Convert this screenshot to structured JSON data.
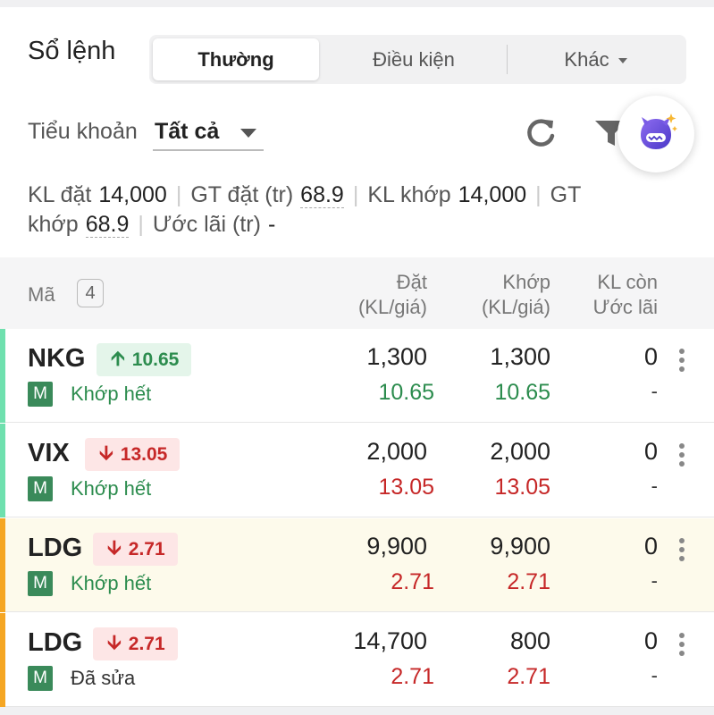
{
  "header": {
    "title": "Sổ lệnh",
    "tabs": [
      "Thường",
      "Điều kiện",
      "Khác"
    ]
  },
  "sub_account": {
    "label": "Tiểu khoản",
    "value": "Tất cả"
  },
  "icons": {
    "refresh": "refresh-icon",
    "filter": "filter-icon",
    "assistant": "assistant-bot-icon"
  },
  "summary": {
    "kl_dat_label": "KL đặt",
    "kl_dat_value": "14,000",
    "gt_dat_label": "GT đặt (tr)",
    "gt_dat_value": "68.9",
    "kl_khop_label": "KL khớp",
    "kl_khop_value": "14,000",
    "gt_khop_label": "GT khớp",
    "gt_khop_value": "68.9",
    "uoc_lai_label": "Ước lãi (tr)",
    "uoc_lai_value": "-"
  },
  "table": {
    "col_ma": "Mã",
    "count": "4",
    "col_dat_1": "Đặt",
    "col_dat_2": "(KL/giá)",
    "col_khop_1": "Khớp",
    "col_khop_2": "(KL/giá)",
    "col_con_1": "KL còn",
    "col_con_2": "Ước lãi",
    "rows": [
      {
        "symbol": "NKG",
        "direction": "up",
        "price_tag": "10.65",
        "badge": "M",
        "status": "Khớp hết",
        "dat_kl": "1,300",
        "dat_gia": "10.65",
        "khop_kl": "1,300",
        "khop_gia": "10.65",
        "kl_con": "0",
        "uoc_lai": "-",
        "bar_color": "#6fe0ae",
        "bg": "#ffffff"
      },
      {
        "symbol": "VIX",
        "direction": "down",
        "price_tag": "13.05",
        "badge": "M",
        "status": "Khớp hết",
        "dat_kl": "2,000",
        "dat_gia": "13.05",
        "khop_kl": "2,000",
        "khop_gia": "13.05",
        "kl_con": "0",
        "uoc_lai": "-",
        "bar_color": "#6fe0ae",
        "bg": "#ffffff"
      },
      {
        "symbol": "LDG",
        "direction": "down",
        "price_tag": "2.71",
        "badge": "M",
        "status": "Khớp hết",
        "dat_kl": "9,900",
        "dat_gia": "2.71",
        "khop_kl": "9,900",
        "khop_gia": "2.71",
        "kl_con": "0",
        "uoc_lai": "-",
        "bar_color": "#f5a623",
        "bg": "#fdfaeb"
      },
      {
        "symbol": "LDG",
        "direction": "down",
        "price_tag": "2.71",
        "badge": "M",
        "status": "Đã sửa",
        "dat_kl": "14,700",
        "dat_gia": "2.71",
        "khop_kl": "800",
        "khop_gia": "2.71",
        "kl_con": "0",
        "uoc_lai": "-",
        "bar_color": "#f5a623",
        "bg": "#ffffff"
      }
    ]
  }
}
